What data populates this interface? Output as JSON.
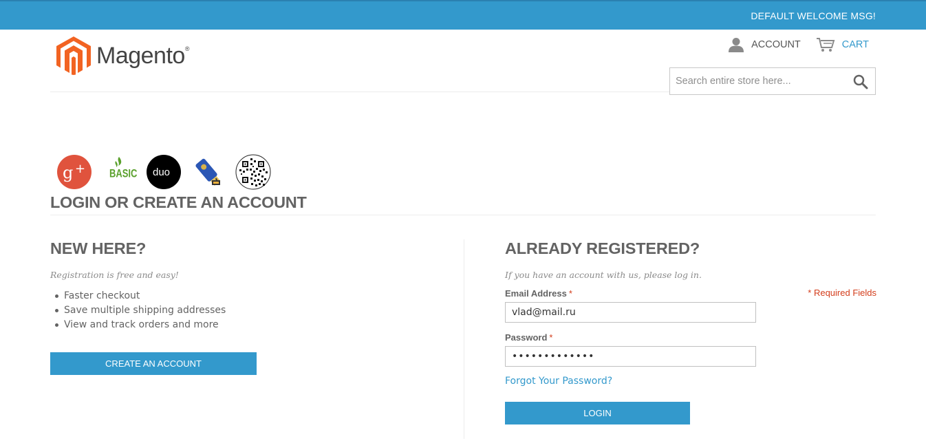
{
  "topbar": {
    "welcome": "DEFAULT WELCOME MSG!",
    "color": "#3399cc"
  },
  "logo": {
    "text": "Magento",
    "reg": "®"
  },
  "header": {
    "account_label": "ACCOUNT",
    "cart_label": "CART"
  },
  "search": {
    "placeholder": "Search entire store here..."
  },
  "providers": [
    "google-plus-icon",
    "basic-icon",
    "duo-icon",
    "usb-key-icon",
    "qr-code-icon"
  ],
  "page": {
    "title": "LOGIN OR CREATE AN ACCOUNT"
  },
  "new_customer": {
    "title": "NEW HERE?",
    "intro": "Registration is free and easy!",
    "benefits": [
      "Faster checkout",
      "Save multiple shipping addresses",
      "View and track orders and more"
    ],
    "button": "CREATE AN ACCOUNT"
  },
  "registered": {
    "title": "ALREADY REGISTERED?",
    "intro": "If you have an account with us, please log in.",
    "required_note": "* Required Fields",
    "email_label": "Email Address",
    "email_value": "vlad@mail.ru",
    "password_label": "Password",
    "password_value": "•••••••••••••",
    "required_mark": "*",
    "forgot": "Forgot Your Password?",
    "button": "LOGIN"
  }
}
